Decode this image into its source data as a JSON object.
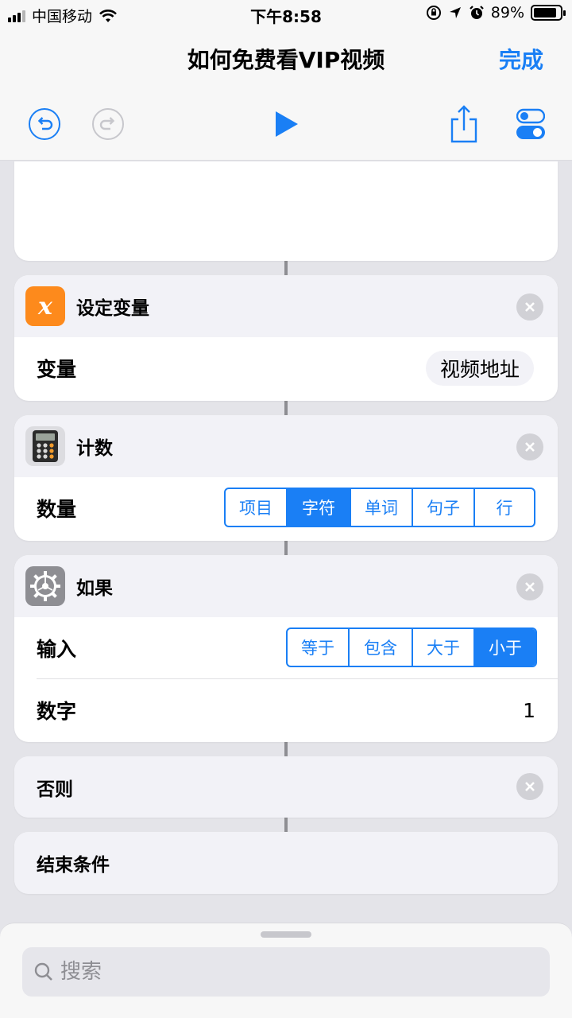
{
  "status": {
    "carrier": "中国移动",
    "time": "下午8:58",
    "battery": "89%",
    "battery_level": 0.89
  },
  "nav": {
    "title": "如何免费看VIP视频",
    "done_label": "完成"
  },
  "actions": {
    "set_variable": {
      "title": "设定变量",
      "icon": "variable-x-icon",
      "icon_glyph": "x",
      "color": "#fd8a1c",
      "row_label": "变量",
      "row_value": "视频地址"
    },
    "count": {
      "title": "计数",
      "icon": "calculator-icon",
      "row_label": "数量",
      "options": [
        "项目",
        "字符",
        "单词",
        "句子",
        "行"
      ],
      "selected": "字符"
    },
    "if": {
      "title": "如果",
      "icon": "gear-icon",
      "input_label": "输入",
      "options": [
        "等于",
        "包含",
        "大于",
        "小于"
      ],
      "selected": "小于",
      "number_label": "数字",
      "number_value": "1"
    },
    "otherwise": {
      "title": "否则"
    },
    "end_if": {
      "title": "结束条件"
    }
  },
  "search": {
    "placeholder": "搜索"
  },
  "colors": {
    "accent": "#1a7ff5"
  }
}
